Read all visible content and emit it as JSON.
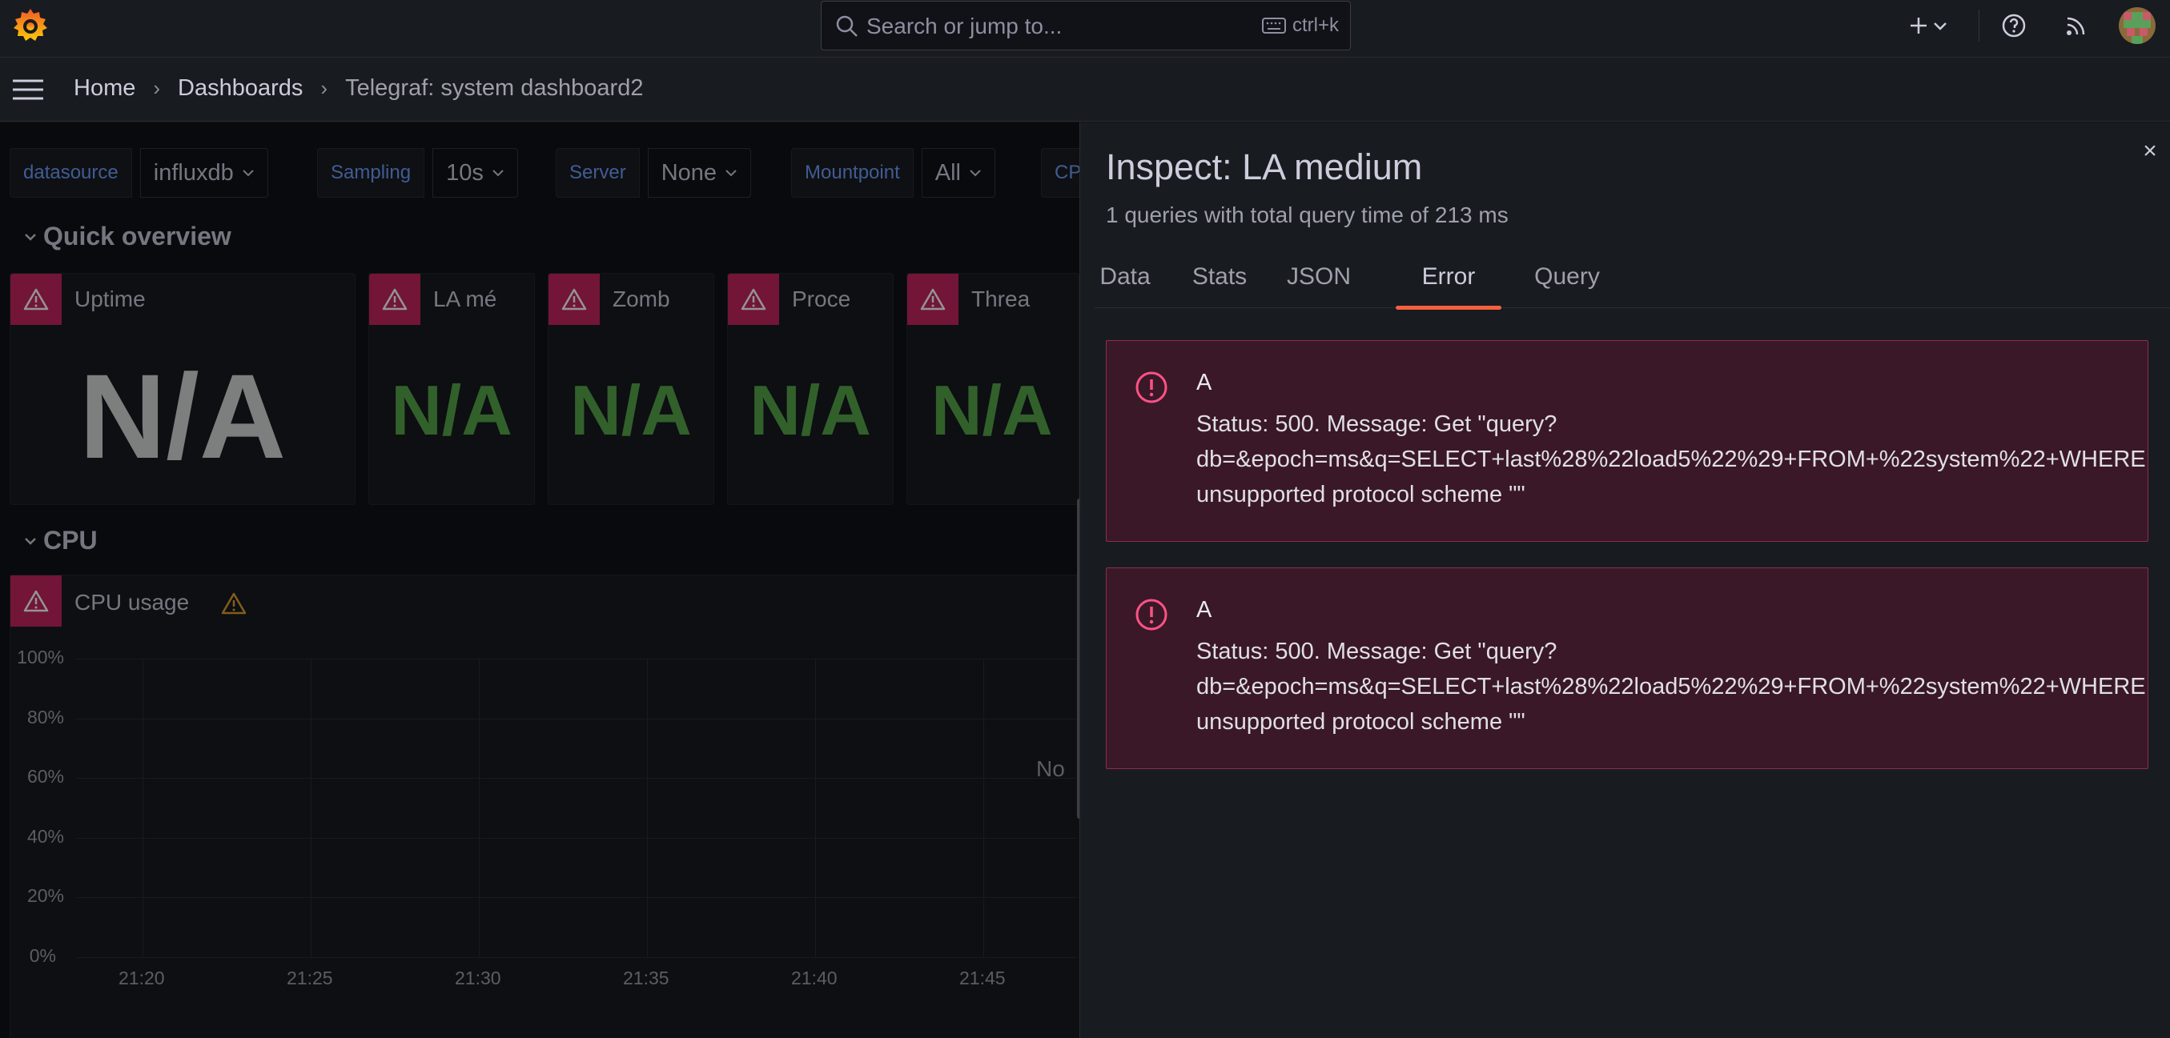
{
  "topbar": {
    "search_placeholder": "Search or jump to...",
    "search_shortcut": "ctrl+k",
    "icons": [
      "grafana-logo-icon",
      "search-icon",
      "keyboard-icon",
      "plus-icon",
      "chevron-down-icon",
      "help-icon",
      "news-rss-icon",
      "user-avatar"
    ]
  },
  "breadcrumb": {
    "home": "Home",
    "dashboards": "Dashboards",
    "current": "Telegraf: system dashboard2"
  },
  "variables": [
    {
      "label": "datasource",
      "value": "influxdb"
    },
    {
      "label": "Sampling",
      "value": "10s"
    },
    {
      "label": "Server",
      "value": "None"
    },
    {
      "label": "Mountpoint",
      "value": "All"
    },
    {
      "label": "CP",
      "value": ""
    }
  ],
  "rows": {
    "quick_overview": "Quick overview",
    "cpu": "CPU"
  },
  "panels": [
    {
      "title": "Uptime",
      "value": "N/A",
      "color": "#d8d9da"
    },
    {
      "title": "LA mé",
      "value": "N/A",
      "color": "#56a64b"
    },
    {
      "title": "Zomb",
      "value": "N/A",
      "color": "#56a64b"
    },
    {
      "title": "Proce",
      "value": "N/A",
      "color": "#56a64b"
    },
    {
      "title": "Threa",
      "value": "N/A",
      "color": "#56a64b"
    }
  ],
  "cpu_panel": {
    "title": "CPU usage",
    "no_data": "No",
    "y_ticks": [
      "100%",
      "80%",
      "60%",
      "40%",
      "20%",
      "0%"
    ],
    "x_ticks": [
      "21:20",
      "21:25",
      "21:30",
      "21:35",
      "21:40",
      "21:45"
    ]
  },
  "drawer": {
    "title": "Inspect: LA medium",
    "subtitle": "1 queries with total query time of 213 ms",
    "close": "×",
    "tabs": [
      "Data",
      "Stats",
      "JSON",
      "Error",
      "Query"
    ],
    "active_tab": "Error",
    "errors": [
      {
        "refid": "A",
        "line1": "Status: 500. Message: Get \"query?",
        "line2": "db=&epoch=ms&q=SELECT+last%28%22load5%22%29+FROM+%22system%22+WHERE",
        "line3": "unsupported protocol scheme \"\""
      },
      {
        "refid": "A",
        "line1": "Status: 500. Message: Get \"query?",
        "line2": "db=&epoch=ms&q=SELECT+last%28%22load5%22%29+FROM+%22system%22+WHERE",
        "line3": "unsupported protocol scheme \"\""
      }
    ]
  },
  "colors": {
    "accent": "#f55f3e",
    "error_bg": "#3a1828",
    "error_border": "#8f2c51",
    "warn_badge": "#c4255e",
    "variable_label": "#6e9fff"
  }
}
